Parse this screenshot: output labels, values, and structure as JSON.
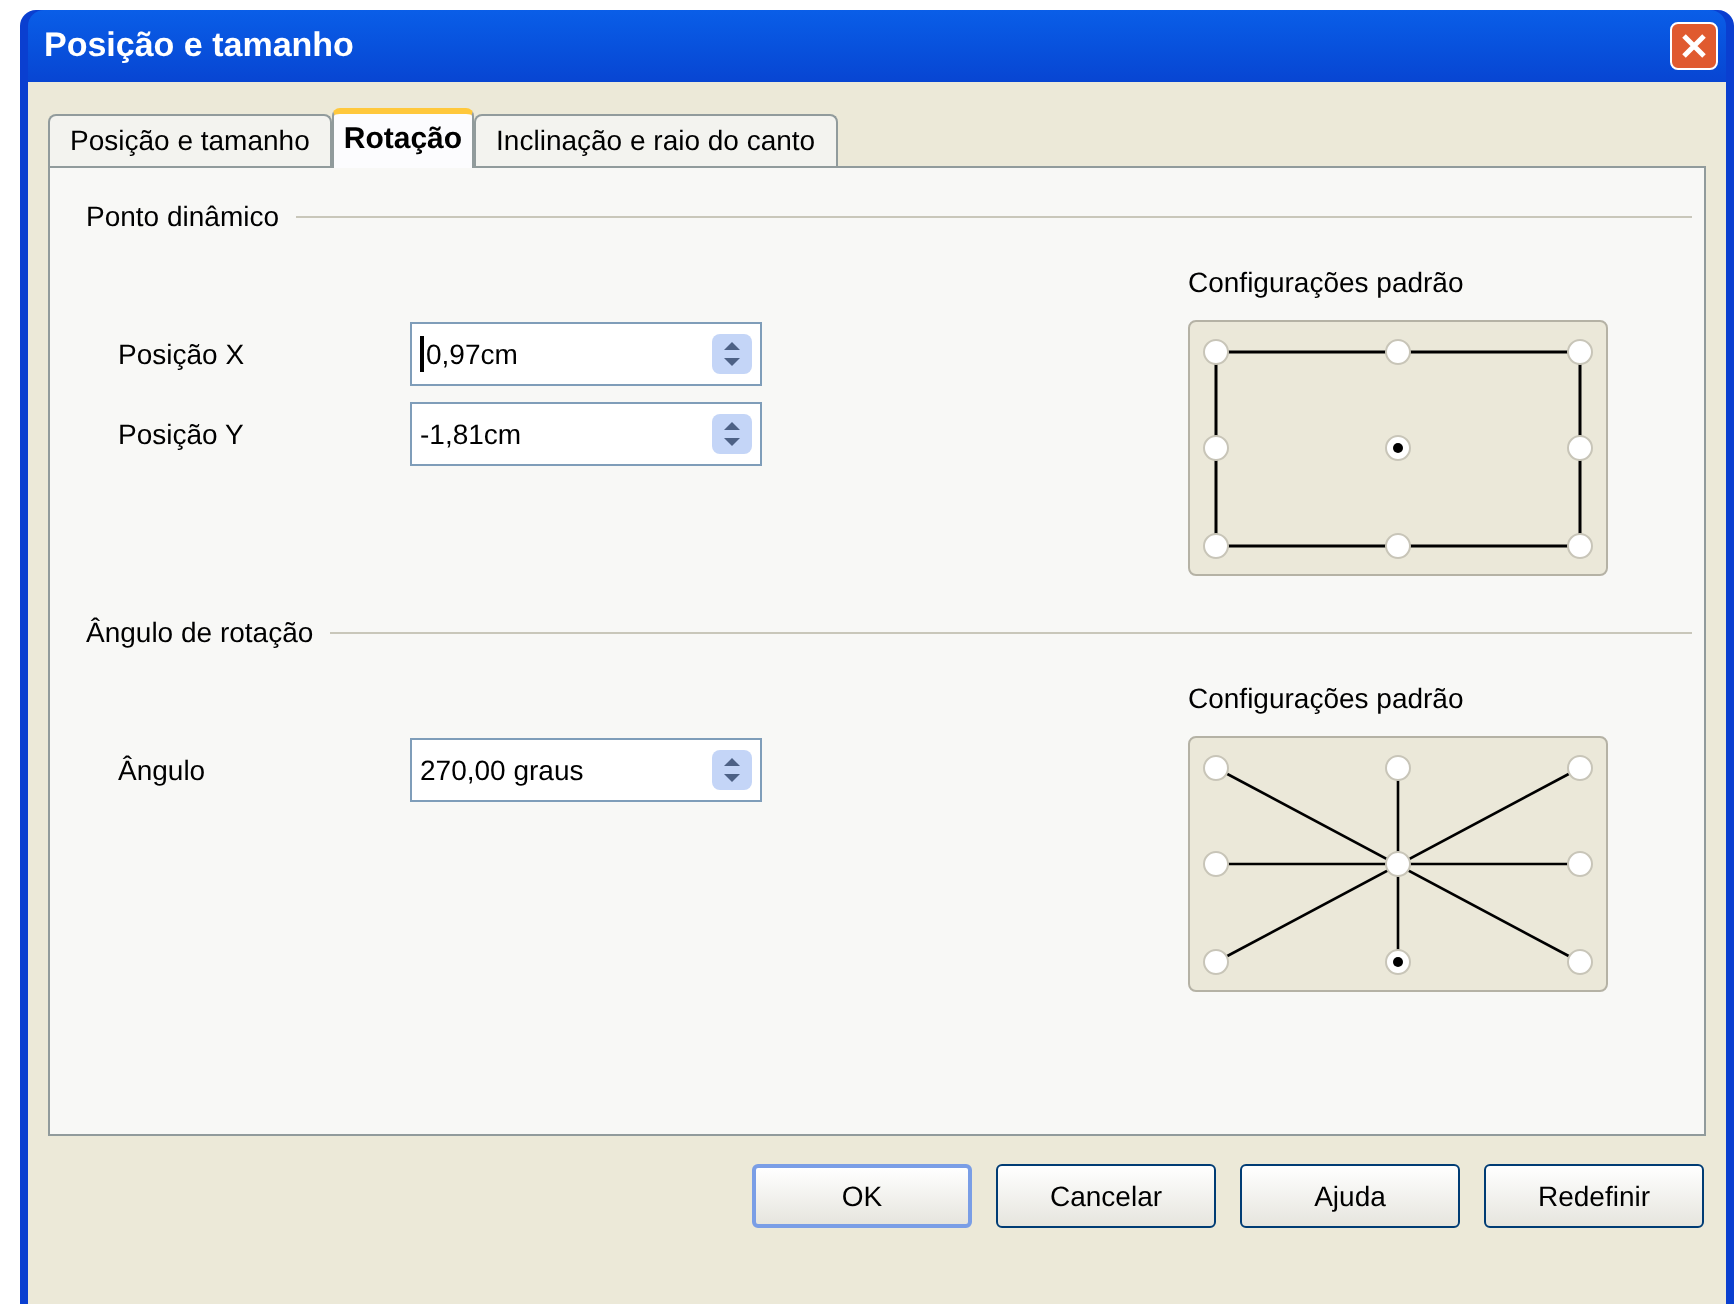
{
  "window": {
    "title": "Posição e tamanho"
  },
  "tabs": [
    {
      "label": "Posição e tamanho",
      "selected": false
    },
    {
      "label": "Rotação",
      "selected": true
    },
    {
      "label": "Inclinação e raio do canto",
      "selected": false
    }
  ],
  "sections": [
    {
      "title": "Ponto dinâmico",
      "fields": [
        {
          "label": "Posição X",
          "value": "0,97cm",
          "focused": true
        },
        {
          "label": "Posição Y",
          "value": "-1,81cm",
          "focused": false
        }
      ],
      "presets": {
        "label": "Configurações padrão",
        "kind": "frame",
        "points": [
          {
            "selected": false
          },
          {
            "selected": false
          },
          {
            "selected": false
          },
          {
            "selected": false
          },
          {
            "selected": true
          },
          {
            "selected": false
          },
          {
            "selected": false
          },
          {
            "selected": false
          },
          {
            "selected": false
          }
        ]
      }
    },
    {
      "title": "Ângulo de rotação",
      "fields": [
        {
          "label": "Ângulo",
          "value": "270,00 graus",
          "focused": false
        }
      ],
      "presets": {
        "label": "Configurações padrão",
        "kind": "star",
        "points": [
          {
            "selected": false
          },
          {
            "selected": false
          },
          {
            "selected": false
          },
          {
            "selected": false
          },
          {
            "selected": false
          },
          {
            "selected": false
          },
          {
            "selected": false
          },
          {
            "selected": true
          },
          {
            "selected": false
          }
        ]
      }
    }
  ],
  "buttons": [
    {
      "label": "OK",
      "default": true
    },
    {
      "label": "Cancelar",
      "default": false
    },
    {
      "label": "Ajuda",
      "default": false
    },
    {
      "label": "Redefinir",
      "default": false
    }
  ]
}
